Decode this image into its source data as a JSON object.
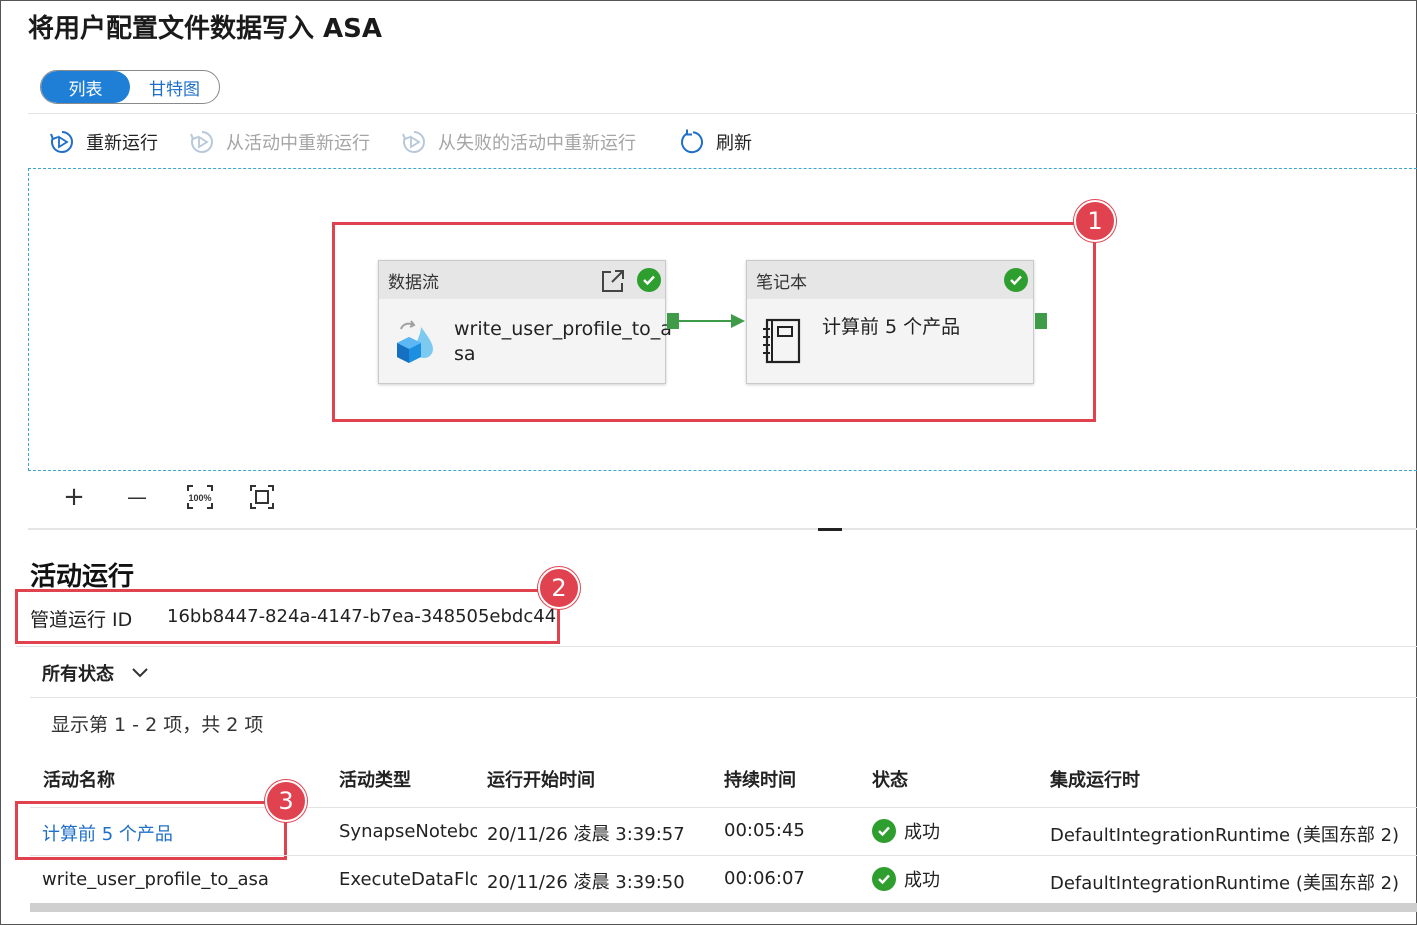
{
  "page": {
    "title": "将用户配置文件数据写入 ASA"
  },
  "view_toggle": {
    "list_label": "列表",
    "gantt_label": "甘特图"
  },
  "toolbar": {
    "rerun_label": "重新运行",
    "rerun_from_activity_label": "从活动中重新运行",
    "rerun_from_failed_label": "从失败的活动中重新运行",
    "refresh_label": "刷新"
  },
  "pipeline": {
    "nodes": [
      {
        "type_label": "数据流",
        "name_line1": "write_user_profile_to_a",
        "name_line2": "sa",
        "status": "succeeded"
      },
      {
        "type_label": "笔记本",
        "name_line1": "计算前 5 个产品",
        "status": "succeeded"
      }
    ]
  },
  "zoom_controls": {
    "zoom_in": "+",
    "zoom_out": "—",
    "zoom_100": "100%"
  },
  "callouts": {
    "one": "1",
    "two": "2",
    "three": "3"
  },
  "activity_runs": {
    "title": "活动运行",
    "run_id_label": "管道运行 ID",
    "run_id_value": "16bb8447-824a-4147-b7ea-348505ebdc44",
    "filter_label": "所有状态",
    "count_text": "显示第 1 - 2 项，共 2 项",
    "columns": [
      "活动名称",
      "活动类型",
      "运行开始时间",
      "持续时间",
      "状态",
      "集成运行时"
    ],
    "rows": [
      {
        "name": "计算前 5 个产品",
        "type": "SynapseNotebook",
        "start": "20/11/26 凌晨 3:39:57",
        "duration": "00:05:45",
        "status": "成功",
        "runtime": "DefaultIntegrationRuntime (美国东部 2)"
      },
      {
        "name": "write_user_profile_to_asa",
        "type": "ExecuteDataFlow",
        "start": "20/11/26 凌晨 3:39:50",
        "duration": "00:06:07",
        "status": "成功",
        "runtime": "DefaultIntegrationRuntime (美国东部 2)"
      }
    ]
  },
  "colors": {
    "accent": "#1f7fd6",
    "link": "#1f6fc8",
    "success": "#2e9e2e",
    "callout": "#e0424f",
    "canvas_border": "#3ba6cf"
  }
}
